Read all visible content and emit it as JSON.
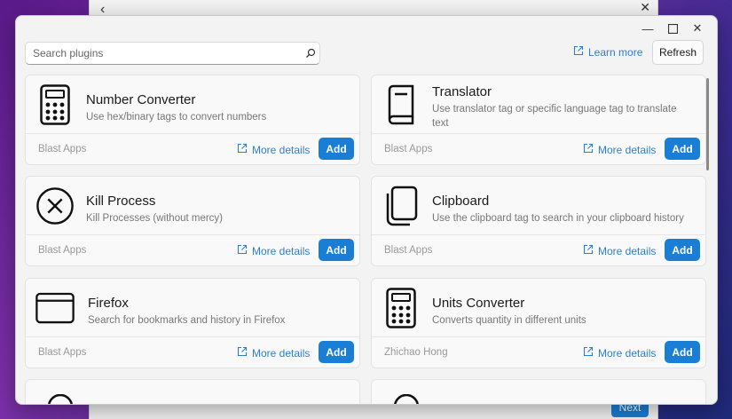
{
  "background_window": {
    "next_label": "Next"
  },
  "search": {
    "placeholder": "Search plugins"
  },
  "header": {
    "learn_more": "Learn more",
    "refresh": "Refresh"
  },
  "colors": {
    "accent": "#1a7fd4",
    "link": "#2b7fd3"
  },
  "plugins": [
    {
      "icon": "calculator-icon",
      "title": "Number Converter",
      "description": "Use hex/binary tags to convert numbers",
      "author": "Blast Apps",
      "more": "More details",
      "add": "Add"
    },
    {
      "icon": "book-icon",
      "title": "Translator",
      "description": "Use translator tag or specific language tag to translate text",
      "author": "Blast Apps",
      "more": "More details",
      "add": "Add"
    },
    {
      "icon": "close-circle-icon",
      "title": "Kill Process",
      "description": "Kill Processes (without mercy)",
      "author": "Blast Apps",
      "more": "More details",
      "add": "Add"
    },
    {
      "icon": "clipboard-icon",
      "title": "Clipboard",
      "description": "Use the clipboard tag to search in your clipboard history",
      "author": "Blast Apps",
      "more": "More details",
      "add": "Add"
    },
    {
      "icon": "window-icon",
      "title": "Firefox",
      "description": "Search for bookmarks and history in Firefox",
      "author": "Blast Apps",
      "more": "More details",
      "add": "Add"
    },
    {
      "icon": "calculator-icon",
      "title": "Units Converter",
      "description": "Converts quantity in different units",
      "author": "Zhichao Hong",
      "more": "More details",
      "add": "Add"
    }
  ]
}
